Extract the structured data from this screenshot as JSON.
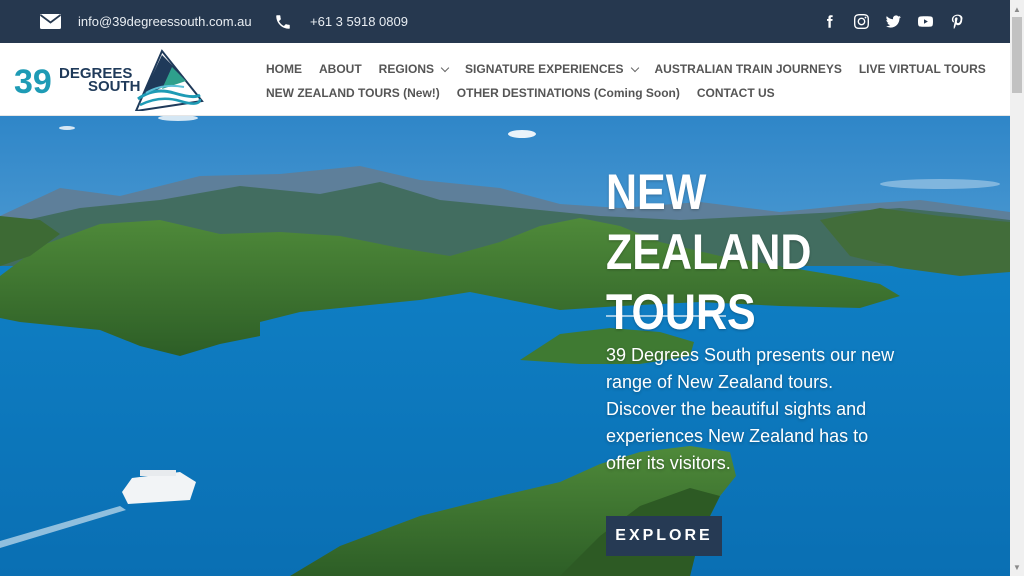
{
  "topbar": {
    "email": "info@39degreessouth.com.au",
    "phone": "+61 3 5918 0809",
    "social_icons": [
      "facebook-icon",
      "instagram-icon",
      "twitter-icon",
      "youtube-icon",
      "pinterest-icon"
    ]
  },
  "logo": {
    "number": "39",
    "line1": "DEGREES",
    "line2": "SOUTH"
  },
  "nav": {
    "row1": [
      {
        "label": "HOME"
      },
      {
        "label": "ABOUT"
      },
      {
        "label": "REGIONS",
        "dropdown": true
      },
      {
        "label": "SIGNATURE EXPERIENCES",
        "dropdown": true
      },
      {
        "label": "AUSTRALIAN TRAIN JOURNEYS"
      },
      {
        "label": "LIVE VIRTUAL TOURS"
      }
    ],
    "row2": [
      {
        "label": "NEW ZEALAND TOURS (New!)"
      },
      {
        "label": "OTHER DESTINATIONS (Coming Soon)"
      },
      {
        "label": "CONTACT US"
      }
    ]
  },
  "hero": {
    "title_line1": "NEW ZEALAND",
    "title_line2": "TOURS",
    "description": "39 Degrees South presents our new range of New Zealand tours. Discover the beautiful sights and experiences New Zealand has to offer its visitors.",
    "button": "EXPLORE"
  },
  "colors": {
    "topbar": "#26384f",
    "button": "#263a54",
    "logo_teal": "#1e9bb5",
    "logo_navy": "#1f3a5a",
    "nav_text": "#555555"
  }
}
